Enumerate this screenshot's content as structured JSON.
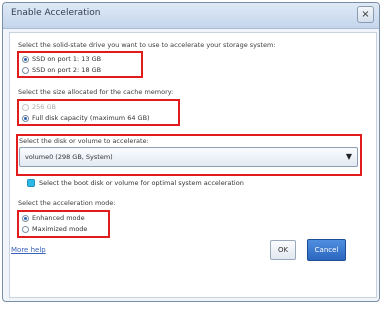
{
  "window": {
    "title": "Enable Acceleration",
    "close_glyph": "×"
  },
  "drive": {
    "question": "Select the solid-state drive you want to use to accelerate your storage system:",
    "options": [
      {
        "label": "SSD on port 1: 13 GB",
        "checked": true
      },
      {
        "label": "SSD on port 2: 18 GB",
        "checked": false
      }
    ]
  },
  "cache_size": {
    "question": "Select the size allocated for the cache memory:",
    "options": [
      {
        "label": "256 GB",
        "checked": false,
        "disabled": true
      },
      {
        "label": "Full disk capacity (maximum 64 GB)",
        "checked": true,
        "disabled": false
      }
    ]
  },
  "volume": {
    "question": "Select the disk or volume to accelerate:",
    "selected": "volume0 (298 GB, System)",
    "checkbox_label": "Select the boot disk or volume for optimal system acceleration",
    "checkbox_checked": true
  },
  "mode": {
    "question": "Select the acceleration mode:",
    "options": [
      {
        "label": "Enhanced mode",
        "checked": true
      },
      {
        "label": "Maximized mode",
        "checked": false
      }
    ]
  },
  "footer": {
    "more_help": "More help",
    "ok": "OK",
    "cancel": "Cancel"
  },
  "highlight_color": "#e21c1c"
}
